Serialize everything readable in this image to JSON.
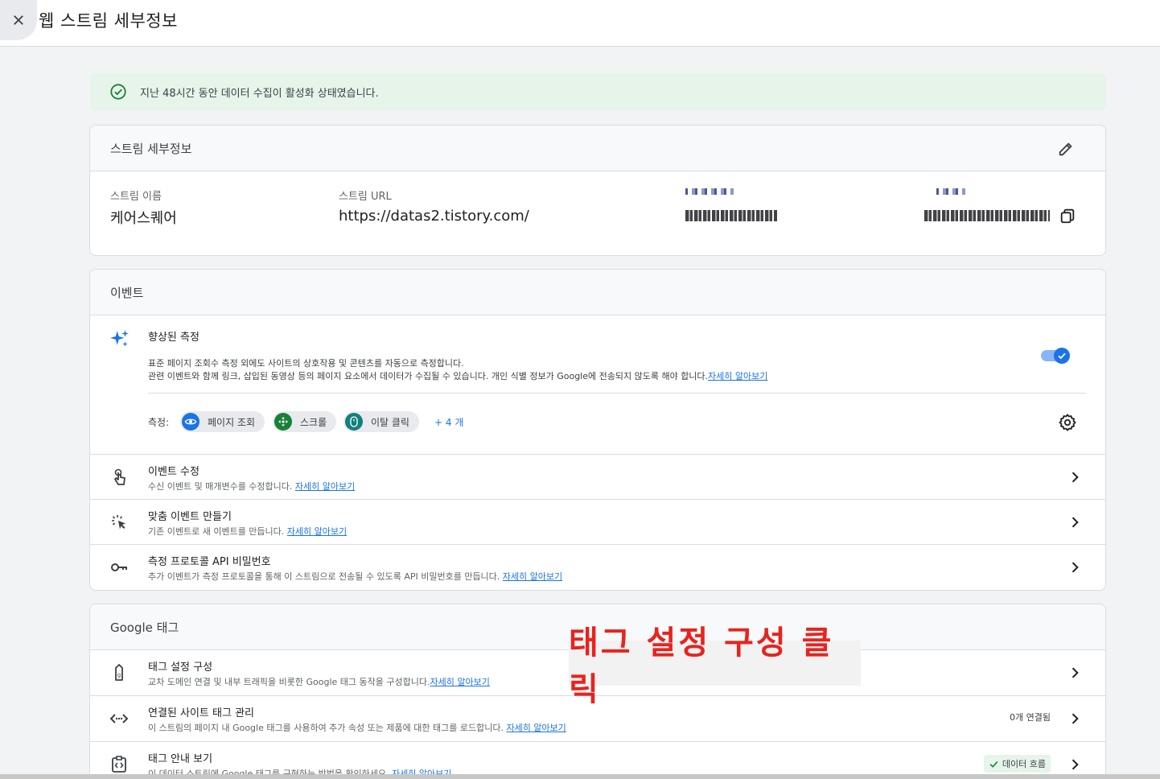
{
  "header": {
    "title": "웹 스트림 세부정보"
  },
  "banner": {
    "text": "지난 48시간 동안 데이터 수집이 활성화 상태였습니다."
  },
  "details": {
    "title": "스트림 세부정보",
    "stream_name_label": "스트림 이름",
    "stream_name": "케어스퀘어",
    "stream_url_label": "스트림 URL",
    "stream_url": "https://datas2.tistory.com/"
  },
  "events": {
    "title": "이벤트",
    "enhanced": {
      "title": "향상된 측정",
      "desc1": "표준 페이지 조회수 측정 외에도 사이트의 상호작용 및 콘텐츠를 자동으로 측정합니다.",
      "desc2": "관련 이벤트와 함께 링크, 삽입된 동영상 등의 페이지 요소에서 데이터가 수집될 수 있습니다. 개인 식별 정보가 Google에 전송되지 않도록 해야 합니다.",
      "learn_more": "자세히 알아보기",
      "toggle_on": true,
      "measure_label": "측정:",
      "chips": [
        "페이지 조회",
        "스크롤",
        "이탈 클릭"
      ],
      "more": "+ 4 개"
    },
    "rows": [
      {
        "title": "이벤트 수정",
        "desc": "수신 이벤트 및 매개변수를 수정합니다.",
        "link": "자세히 알아보기"
      },
      {
        "title": "맞춤 이벤트 만들기",
        "desc": "기존 이벤트로 새 이벤트를 만듭니다.",
        "link": "자세히 알아보기"
      },
      {
        "title": "측정 프로토콜 API 비밀번호",
        "desc": "추가 이벤트가 측정 프로토콜을 통해 이 스트림으로 전송될 수 있도록 API 비밀번호를 만듭니다.",
        "link": "자세히 알아보기"
      }
    ]
  },
  "google_tag": {
    "title": "Google 태그",
    "rows": [
      {
        "title": "태그 설정 구성",
        "desc": "교차 도메인 연결 및 내부 트래픽을 비롯한 Google 태그 동작을 구성합니다.",
        "link": "자세히 알아보기"
      },
      {
        "title": "연결된 사이트 태그 관리",
        "desc": "이 스트림의 페이지 내 Google 태그를 사용하여 추가 속성 또는 제품에 대한 태그를 로드합니다.",
        "link": "자세히 알아보기",
        "badge": "0개 연결됨"
      },
      {
        "title": "태그 안내 보기",
        "desc": "이 데이터 스트림에 Google 태그를 구현하는 방법을 확인하세요.",
        "link": "자세히 알아보기",
        "badge": "데이터 흐름"
      }
    ]
  },
  "annotation": {
    "text": "태그 설정 구성 클릭"
  },
  "colors": {
    "accent": "#1a73e8",
    "success_bg": "#e6f4ea",
    "success": "#188038",
    "annotation": "#e8231e"
  }
}
